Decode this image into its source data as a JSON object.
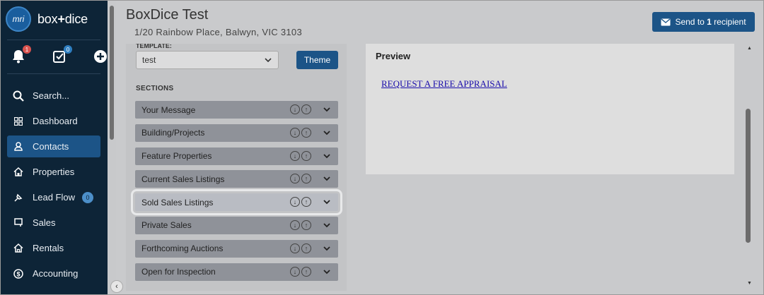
{
  "brand": {
    "logo_text": "mri",
    "name_part1": "box",
    "name_plus": "+",
    "name_part2": "dice"
  },
  "icons": {
    "notifications_badge": "1",
    "tasks_badge": "0"
  },
  "nav": [
    {
      "label": "Search...",
      "icon": "search-icon"
    },
    {
      "label": "Dashboard",
      "icon": "dashboard-icon"
    },
    {
      "label": "Contacts",
      "icon": "contacts-icon",
      "active": true
    },
    {
      "label": "Properties",
      "icon": "properties-icon"
    },
    {
      "label": "Lead Flow",
      "icon": "lead-flow-icon",
      "badge": "0"
    },
    {
      "label": "Sales",
      "icon": "sales-icon"
    },
    {
      "label": "Rentals",
      "icon": "rentals-icon"
    },
    {
      "label": "Accounting",
      "icon": "accounting-icon"
    }
  ],
  "header": {
    "title": "BoxDice Test",
    "subtitle": "1/20 Rainbow Place, Balwyn, VIC 3103",
    "send_prefix": "Send to ",
    "send_count": "1",
    "send_suffix": " recipient"
  },
  "template": {
    "label": "TEMPLATE:",
    "value": "test",
    "theme_label": "Theme"
  },
  "sections_heading": "SECTIONS",
  "sections": [
    "Your Message",
    "Building/Projects",
    "Feature Properties",
    "Current Sales Listings",
    "Sold Sales Listings",
    "Private Sales",
    "Forthcoming Auctions",
    "Open for Inspection"
  ],
  "preview": {
    "title": "Preview",
    "link_text": "REQUEST A FREE APPRAISAL"
  },
  "colors": {
    "sidebar": "#0d2437",
    "accent": "#1c5487",
    "section_row": "#8f9299"
  }
}
